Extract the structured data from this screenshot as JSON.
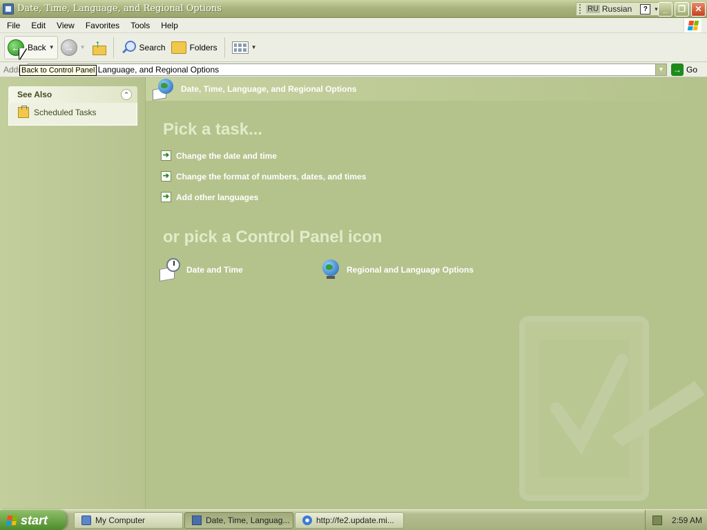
{
  "window": {
    "title": "Date, Time, Language, and Regional Options"
  },
  "language_bar": {
    "code": "RU",
    "name": "Russian",
    "help": "?"
  },
  "menu": {
    "items": [
      "File",
      "Edit",
      "View",
      "Favorites",
      "Tools",
      "Help"
    ]
  },
  "toolbar": {
    "back_label": "Back",
    "search_label": "Search",
    "folders_label": "Folders"
  },
  "address": {
    "label": "Address",
    "value": "Date, Time, Language, and Regional Options",
    "go_label": "Go"
  },
  "tooltip": {
    "text": "Back to Control Panel"
  },
  "see_also": {
    "title": "See Also",
    "items": [
      {
        "label": "Scheduled Tasks",
        "icon": "scheduled-tasks-icon"
      }
    ]
  },
  "main": {
    "header": "Date, Time, Language, and Regional Options",
    "pick_task_title": "Pick a task...",
    "tasks": [
      "Change the date and time",
      "Change the format of numbers, dates, and times",
      "Add other languages"
    ],
    "pick_icon_title": "or pick a Control Panel icon",
    "icons": [
      {
        "label": "Date and Time",
        "icon": "date-time-icon"
      },
      {
        "label": "Regional and Language Options",
        "icon": "globe-icon"
      }
    ]
  },
  "taskbar": {
    "start_label": "start",
    "buttons": [
      {
        "label": "My Computer",
        "active": false
      },
      {
        "label": "Date, Time, Languag...",
        "active": true
      },
      {
        "label": "http://fe2.update.mi...",
        "active": false
      }
    ],
    "clock": "2:59 AM"
  },
  "colors": {
    "theme": "#b4c28c",
    "accent_green": "#1d8a1a"
  }
}
